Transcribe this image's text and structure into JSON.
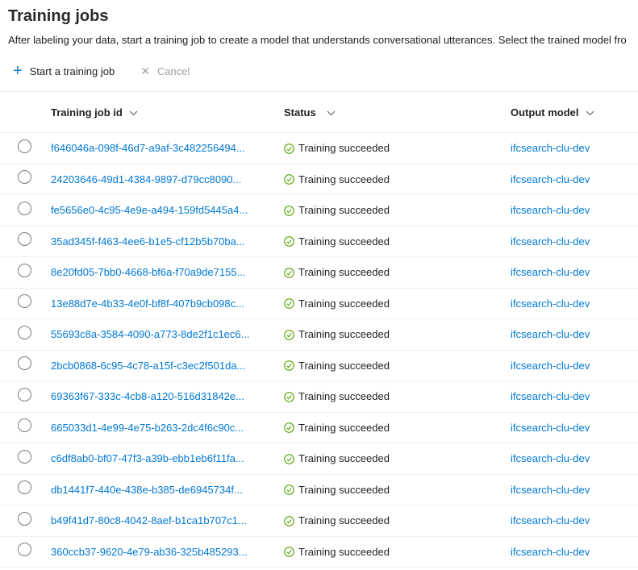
{
  "page": {
    "title": "Training jobs",
    "description": "After labeling your data, start a training job to create a model that understands conversational utterances. Select the trained model fro"
  },
  "toolbar": {
    "plus_icon": "+",
    "start_label": "Start a training job",
    "cancel_icon": "✕",
    "cancel_label": "Cancel",
    "cancel_disabled": true
  },
  "table": {
    "columns": [
      "Training job id",
      "Status",
      "Output model"
    ],
    "rows": [
      {
        "id": "f646046a-098f-46d7-a9af-3c482256494...",
        "status": "Training succeeded",
        "output_model": "ifcsearch-clu-dev"
      },
      {
        "id": "24203646-49d1-4384-9897-d79cc8090...",
        "status": "Training succeeded",
        "output_model": "ifcsearch-clu-dev"
      },
      {
        "id": "fe5656e0-4c95-4e9e-a494-159fd5445a4...",
        "status": "Training succeeded",
        "output_model": "ifcsearch-clu-dev"
      },
      {
        "id": "35ad345f-f463-4ee6-b1e5-cf12b5b70ba...",
        "status": "Training succeeded",
        "output_model": "ifcsearch-clu-dev"
      },
      {
        "id": "8e20fd05-7bb0-4668-bf6a-f70a9de7155...",
        "status": "Training succeeded",
        "output_model": "ifcsearch-clu-dev"
      },
      {
        "id": "13e88d7e-4b33-4e0f-bf8f-407b9cb098c...",
        "status": "Training succeeded",
        "output_model": "ifcsearch-clu-dev"
      },
      {
        "id": "55693c8a-3584-4090-a773-8de2f1c1ec6...",
        "status": "Training succeeded",
        "output_model": "ifcsearch-clu-dev"
      },
      {
        "id": "2bcb0868-6c95-4c78-a15f-c3ec2f501da...",
        "status": "Training succeeded",
        "output_model": "ifcsearch-clu-dev"
      },
      {
        "id": "69363f67-333c-4cb8-a120-516d31842e...",
        "status": "Training succeeded",
        "output_model": "ifcsearch-clu-dev"
      },
      {
        "id": "665033d1-4e99-4e75-b263-2dc4f6c90c...",
        "status": "Training succeeded",
        "output_model": "ifcsearch-clu-dev"
      },
      {
        "id": "c6df8ab0-bf07-47f3-a39b-ebb1eb6f11fa...",
        "status": "Training succeeded",
        "output_model": "ifcsearch-clu-dev"
      },
      {
        "id": "db1441f7-440e-438e-b385-de6945734f...",
        "status": "Training succeeded",
        "output_model": "ifcsearch-clu-dev"
      },
      {
        "id": "b49f41d7-80c8-4042-8aef-b1ca1b707c1...",
        "status": "Training succeeded",
        "output_model": "ifcsearch-clu-dev"
      },
      {
        "id": "360ccb37-9620-4e79-ab36-325b485293...",
        "status": "Training succeeded",
        "output_model": "ifcsearch-clu-dev"
      }
    ]
  },
  "colors": {
    "accent_blue": "#0078d4",
    "success_green": "#57a300",
    "disabled_gray": "#a19f9d",
    "text_dark": "#201f1e",
    "divider": "#ececec"
  }
}
